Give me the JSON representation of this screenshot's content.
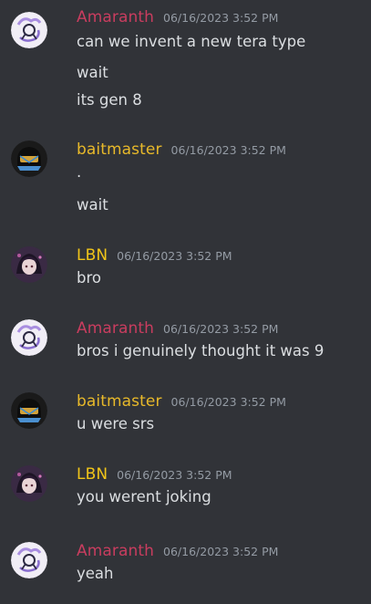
{
  "colors": {
    "background": "#313338",
    "amaranth": "#c93d5f",
    "baitmaster": "#e8b92a",
    "lbn": "#f0c419",
    "timestamp": "#949ba4",
    "text": "#dbdee1"
  },
  "messages": [
    {
      "avatar_icon": "white-purple-avatar-icon",
      "username": "Amaranth",
      "timestamp": "06/16/2023 3:52 PM",
      "lines": [
        "can we invent a new tera type",
        "wait",
        "its gen 8"
      ]
    },
    {
      "avatar_icon": "helmet-avatar-icon",
      "username": "baitmaster",
      "timestamp": "06/16/2023 3:52 PM",
      "lines": [
        ".",
        "wait"
      ]
    },
    {
      "avatar_icon": "anime-girl-avatar-icon",
      "username": "LBN",
      "timestamp": "06/16/2023 3:52 PM",
      "lines": [
        "bro"
      ]
    },
    {
      "avatar_icon": "white-purple-avatar-icon",
      "username": "Amaranth",
      "timestamp": "06/16/2023 3:52 PM",
      "lines": [
        "bros i genuinely thought it was 9"
      ]
    },
    {
      "avatar_icon": "helmet-avatar-icon",
      "username": "baitmaster",
      "timestamp": "06/16/2023 3:52 PM",
      "lines": [
        "u were srs"
      ]
    },
    {
      "avatar_icon": "anime-girl-avatar-icon",
      "username": "LBN",
      "timestamp": "06/16/2023 3:52 PM",
      "lines": [
        "you werent joking"
      ]
    },
    {
      "avatar_icon": "white-purple-avatar-icon",
      "username": "Amaranth",
      "timestamp": "06/16/2023 3:52 PM",
      "lines": [
        "yeah"
      ]
    }
  ]
}
